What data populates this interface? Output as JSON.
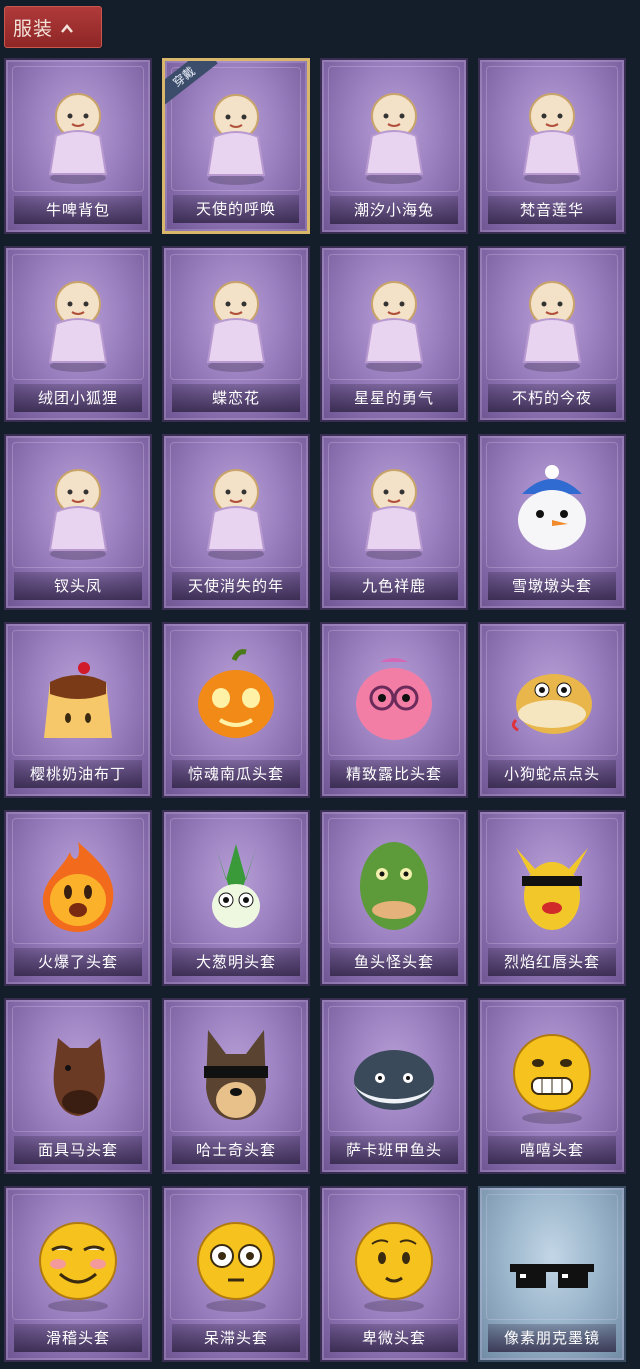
{
  "header": {
    "title": "服装"
  },
  "colors": {
    "card_purple": "#9a7fbf",
    "card_blue": "#98b3c9",
    "header_red": "#a53131",
    "equipped_gold": "#d9b76a"
  },
  "badge_equipped": "穿戴",
  "items": [
    {
      "name": "牛啤背包",
      "icon": "beer-cow-icon",
      "style": "purple"
    },
    {
      "name": "天使的呼唤",
      "icon": "angel-call-icon",
      "style": "purple",
      "equipped": true
    },
    {
      "name": "潮汐小海兔",
      "icon": "sea-bunny-icon",
      "style": "purple"
    },
    {
      "name": "梵音莲华",
      "icon": "lotus-girl-icon",
      "style": "purple"
    },
    {
      "name": "绒团小狐狸",
      "icon": "fox-icon",
      "style": "purple"
    },
    {
      "name": "蝶恋花",
      "icon": "bell-wreath-icon",
      "style": "purple"
    },
    {
      "name": "星星的勇气",
      "icon": "star-prince-icon",
      "style": "purple"
    },
    {
      "name": "不朽的今夜",
      "icon": "pink-cat-icon",
      "style": "purple"
    },
    {
      "name": "钗头凤",
      "icon": "phoenix-crown-icon",
      "style": "purple"
    },
    {
      "name": "天使消失的年",
      "icon": "angel-girl-icon",
      "style": "purple"
    },
    {
      "name": "九色祥鹿",
      "icon": "deer-icon",
      "style": "purple"
    },
    {
      "name": "雪墩墩头套",
      "icon": "snowman-head-icon",
      "style": "purple"
    },
    {
      "name": "樱桃奶油布丁",
      "icon": "pudding-icon",
      "style": "purple"
    },
    {
      "name": "惊魂南瓜头套",
      "icon": "pumpkin-icon",
      "style": "purple"
    },
    {
      "name": "精致露比头套",
      "icon": "pink-beaver-icon",
      "style": "purple"
    },
    {
      "name": "小狗蛇点点头",
      "icon": "snake-head-icon",
      "style": "purple"
    },
    {
      "name": "火爆了头套",
      "icon": "fire-head-icon",
      "style": "purple"
    },
    {
      "name": "大葱明头套",
      "icon": "scallion-head-icon",
      "style": "purple"
    },
    {
      "name": "鱼头怪头套",
      "icon": "fish-head-icon",
      "style": "purple"
    },
    {
      "name": "烈焰红唇头套",
      "icon": "pikachu-head-icon",
      "style": "purple"
    },
    {
      "name": "面具马头套",
      "icon": "horse-head-icon",
      "style": "purple"
    },
    {
      "name": "哈士奇头套",
      "icon": "husky-head-icon",
      "style": "purple"
    },
    {
      "name": "萨卡班甲鱼头",
      "icon": "sacabambaspis-icon",
      "style": "purple"
    },
    {
      "name": "嘻嘻头套",
      "icon": "grin-emoji-icon",
      "style": "purple"
    },
    {
      "name": "滑稽头套",
      "icon": "funny-emoji-icon",
      "style": "purple"
    },
    {
      "name": "呆滞头套",
      "icon": "stare-emoji-icon",
      "style": "purple"
    },
    {
      "name": "卑微头套",
      "icon": "humble-emoji-icon",
      "style": "purple"
    },
    {
      "name": "像素朋克墨镜",
      "icon": "pixel-sunglasses-icon",
      "style": "blue"
    }
  ]
}
